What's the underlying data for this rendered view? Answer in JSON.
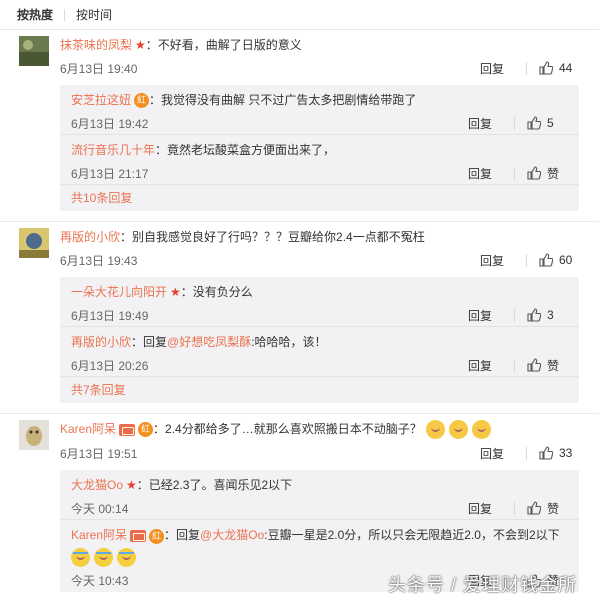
{
  "sort": {
    "hot": "按热度",
    "time": "按时间"
  },
  "comments": [
    {
      "user": "抹茶味的凤梨",
      "text": "：不好看，曲解了日版的意义",
      "time": "6月13日 19:40",
      "reply": "回复",
      "likes": "44",
      "subs": [
        {
          "user": "安芝拉这妞",
          "text": "：我觉得没有曲解 只不过广告太多把剧情给带跑了",
          "time": "6月13日 19:42",
          "reply": "回复",
          "likes": "5"
        },
        {
          "user": "流行音乐几十年",
          "text": "：竟然老坛酸菜盒方便面出来了，",
          "time": "6月13日 21:17",
          "reply": "回复",
          "likes": "赞"
        }
      ],
      "more": "共10条回复"
    },
    {
      "user": "再版的小欣",
      "text": "：别自我感觉良好了行吗？？？豆瓣给你2.4一点都不冤枉",
      "time": "6月13日 19:43",
      "reply": "回复",
      "likes": "60",
      "subs": [
        {
          "user": "一朵大花儿向阳开",
          "text": "：没有负分么",
          "time": "6月13日 19:49",
          "reply": "回复",
          "likes": "3"
        },
        {
          "user": "再版的小欣",
          "text": "：回复",
          "mention": "@好想吃凤梨酥",
          "text2": ":哈哈哈，该！",
          "time": "6月13日 20:26",
          "reply": "回复",
          "likes": "赞"
        }
      ],
      "more": "共7条回复"
    },
    {
      "user": "Karen阿呆",
      "text": "：2.4分都给多了…就那么喜欢照搬日本不动脑子？",
      "time": "6月13日 19:51",
      "reply": "回复",
      "likes": "33",
      "subs": [
        {
          "user": "大龙猫Oo",
          "text": "：已经2.3了。喜闻乐见2以下",
          "time": "今天 00:14",
          "reply": "回复",
          "likes": "赞"
        },
        {
          "user": "Karen阿呆",
          "text": "：回复",
          "mention": "@大龙猫Oo",
          "text2": ":豆瓣一星是2.0分，所以只会无限趋近2.0，不会到2以下",
          "time": "今天 10:43",
          "reply": "回复",
          "likes": "赞"
        }
      ]
    }
  ],
  "watermark": "头条号 / 爱理财钱金所",
  "colors": {
    "username": "#eb7350",
    "subbox_bg": "#f2f2f5"
  }
}
